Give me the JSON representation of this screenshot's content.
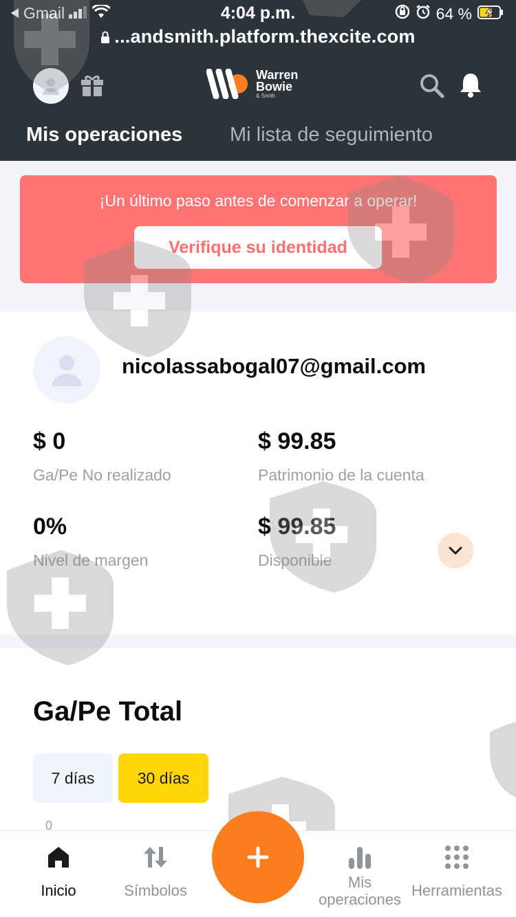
{
  "status_bar": {
    "back_app": "Gmail",
    "time": "4:04 p.m.",
    "battery": "64 %",
    "url": "...andsmith.platform.thexcite.com"
  },
  "header": {
    "logo_line1": "Warren",
    "logo_line2": "Bowie",
    "logo_line3": "& Smith",
    "tabs": [
      {
        "label": "Mis operaciones"
      },
      {
        "label": "Mi lista de seguimiento"
      }
    ]
  },
  "banner": {
    "message": "¡Un último paso antes de comenzar a operar!",
    "button_label": "Verifique su identidad"
  },
  "account": {
    "email": "nicolassabogal07@gmail.com",
    "metrics": [
      {
        "value": "$ 0",
        "label": "Ga/Pe No realizado"
      },
      {
        "value": "$ 99.85",
        "label": "Patrimonio de la cuenta"
      },
      {
        "value": "0%",
        "label": "Nivel de margen"
      },
      {
        "value": "$ 99.85",
        "label": "Disponible"
      }
    ]
  },
  "pnl": {
    "title": "Ga/Pe Total",
    "periods": [
      {
        "label": "7 días",
        "selected": false
      },
      {
        "label": "30 días",
        "selected": true
      }
    ],
    "tick_label": "0"
  },
  "bottom_nav": {
    "items": [
      {
        "label": "Inicio",
        "icon": "home-icon"
      },
      {
        "label": "Símbolos",
        "icon": "arrows-updown-icon"
      },
      {
        "label": "",
        "icon": "plus-icon"
      },
      {
        "label": "Mis operaciones",
        "icon": "bar-chart-icon"
      },
      {
        "label": "Herramientas",
        "icon": "grid-dots-icon"
      }
    ]
  },
  "colors": {
    "header_bg": "#2c3339",
    "banner_bg": "#ff7373",
    "accent_orange": "#fb7d1e",
    "period_selected": "#ffd60a"
  }
}
